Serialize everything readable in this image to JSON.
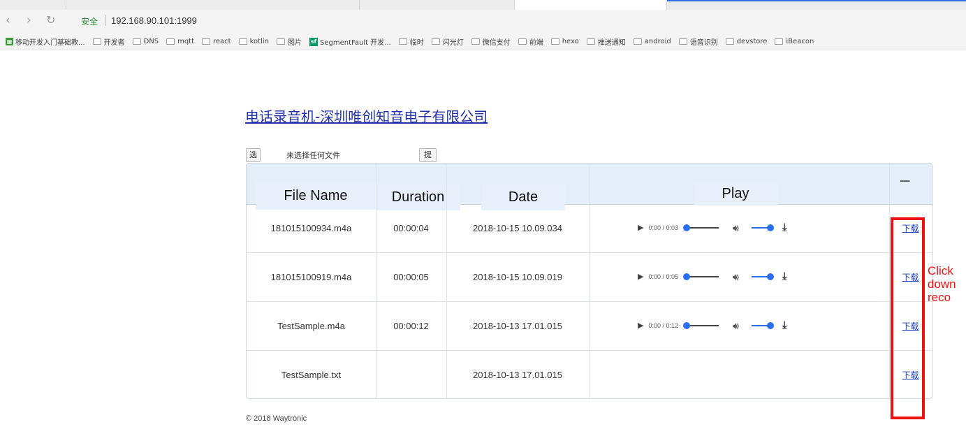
{
  "browser": {
    "secure_label": "安全",
    "url": "192.168.90.101:1999",
    "bookmarks": [
      {
        "label": "移动开发入门基础教...",
        "icon": "green-app-icon"
      },
      {
        "label": "开发者",
        "icon": "folder-icon"
      },
      {
        "label": "DNS",
        "icon": "folder-icon"
      },
      {
        "label": "mqtt",
        "icon": "folder-icon"
      },
      {
        "label": "react",
        "icon": "folder-icon"
      },
      {
        "label": "kotlin",
        "icon": "folder-icon"
      },
      {
        "label": "图片",
        "icon": "folder-icon"
      },
      {
        "label": "SegmentFault 开发...",
        "icon": "segmentfault-icon"
      },
      {
        "label": "临时",
        "icon": "folder-icon"
      },
      {
        "label": "闪光灯",
        "icon": "folder-icon"
      },
      {
        "label": "微信支付",
        "icon": "folder-icon"
      },
      {
        "label": "前端",
        "icon": "folder-icon"
      },
      {
        "label": "hexo",
        "icon": "folder-icon"
      },
      {
        "label": "推送通知",
        "icon": "folder-icon"
      },
      {
        "label": "android",
        "icon": "folder-icon"
      },
      {
        "label": "语音识别",
        "icon": "folder-icon"
      },
      {
        "label": "devstore",
        "icon": "folder-icon"
      },
      {
        "label": "iBeacon",
        "icon": "folder-icon"
      }
    ]
  },
  "page": {
    "title": "电话录音机-深圳唯创知音电子有限公司",
    "upload": {
      "choose_label": "选择文件",
      "no_file_label": "未选择任何文件",
      "submit_label": "提交"
    },
    "table": {
      "headers": {
        "name": "File Name",
        "duration": "Duration",
        "date": "Date",
        "play": "Play"
      },
      "rows": [
        {
          "name": "181015100934.m4a",
          "duration": "00:00:04",
          "date": "2018-10-15 10.09.034",
          "player_time": "0:00 / 0:03",
          "has_player": true,
          "download": "下载"
        },
        {
          "name": "181015100919.m4a",
          "duration": "00:00:05",
          "date": "2018-10-15 10.09.019",
          "player_time": "0:00 / 0:05",
          "has_player": true,
          "download": "下载"
        },
        {
          "name": "TestSample.m4a",
          "duration": "00:00:12",
          "date": "2018-10-13 17.01.015",
          "player_time": "0:00 / 0:12",
          "has_player": true,
          "download": "下载"
        },
        {
          "name": "TestSample.txt",
          "duration": "",
          "date": "2018-10-13 17.01.015",
          "player_time": "",
          "has_player": false,
          "download": "下载"
        }
      ]
    },
    "annotation": "Click\ndown\nreco",
    "footer": "© 2018 Waytronic"
  },
  "colors": {
    "link": "#1a3fbf",
    "annotation": "#e11111",
    "header_bg": "#e4eef8",
    "player_accent": "#2b6ff0"
  }
}
